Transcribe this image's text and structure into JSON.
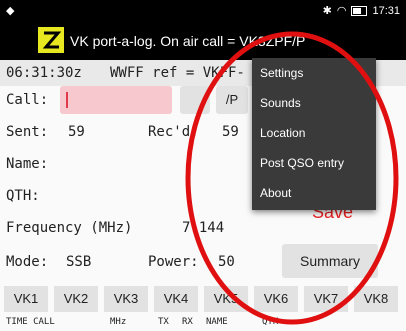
{
  "status": {
    "time": "17:31",
    "left_icon": "android-icon"
  },
  "appbar": {
    "title": "VK port-a-log. On air call = VK3ZPF/P"
  },
  "timebar": {
    "utc": "06:31:30z",
    "wwff": "WWFF ref = VKFF-"
  },
  "form": {
    "call_label": "Call:",
    "portable_label": "/P",
    "sent_label": "Sent:",
    "sent_value": "59",
    "recd_label": "Rec'd:",
    "recd_value": "59",
    "name_label": "Name:",
    "qth_label": "QTH:",
    "freq_label": "Frequency (MHz)",
    "freq_value": "7.144",
    "mode_label": "Mode:",
    "mode_value": "SSB",
    "power_label": "Power:",
    "power_value": "50"
  },
  "menu": {
    "items": [
      "Settings",
      "Sounds",
      "Location",
      "Post QSO entry",
      "About"
    ]
  },
  "buttons": {
    "save": "Save",
    "summary": "Summary"
  },
  "vk_buttons": [
    "VK1",
    "VK2",
    "VK3",
    "VK4",
    "VK5",
    "VK6",
    "VK7",
    "VK8"
  ],
  "log_headers": [
    "TIME CALL",
    "MHz",
    "TX",
    "RX",
    "NAME",
    "QTH"
  ],
  "colors": {
    "call_bg": "#f7c9cf",
    "save": "#e82020",
    "annotation_circle": "#e01010"
  }
}
